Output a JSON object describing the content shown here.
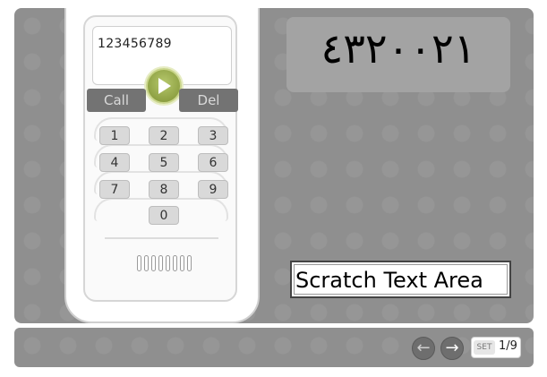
{
  "phone": {
    "display_value": "123456789",
    "call_label": "Call",
    "del_label": "Del",
    "keys": [
      "1",
      "2",
      "3",
      "4",
      "5",
      "6",
      "7",
      "8",
      "9",
      "0"
    ]
  },
  "target_number": "١٢٠٠٢٣٤",
  "scratch": {
    "text": "Scratch Text Area"
  },
  "navigation": {
    "prev_icon": "left-arrow-icon",
    "next_icon": "right-arrow-icon",
    "set_label": "SET",
    "page_indicator": "1/9"
  },
  "colors": {
    "panel_gray": "#8f8f8f",
    "play_green": "#9aae48",
    "button_gray": "#737373"
  }
}
